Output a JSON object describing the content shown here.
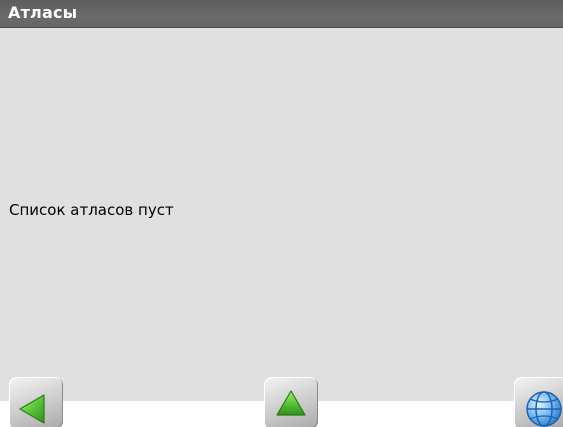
{
  "title_bar": {
    "title": "Атласы"
  },
  "content": {
    "empty_message": "Список атласов пуст"
  },
  "toolbar": {
    "back_icon": "green-left-arrow-icon",
    "up_icon": "green-up-arrow-icon",
    "map_icon": "blue-globe-icon",
    "colors": {
      "title_bar": "#666666",
      "content_bg": "#e0e0e0",
      "arrow_green": "#4caf2a",
      "globe_blue": "#3a8fe0"
    }
  }
}
